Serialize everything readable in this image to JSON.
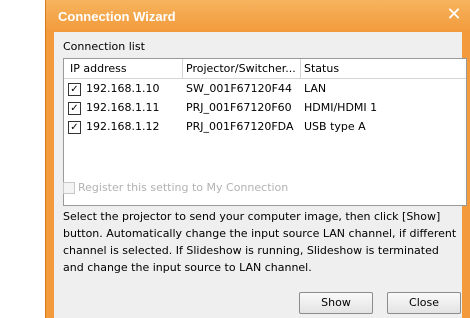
{
  "window": {
    "title": "Connection Wizard",
    "close_glyph": "✕",
    "accent_color": "#f39a3c"
  },
  "list": {
    "label": "Connection list",
    "columns": [
      "IP address",
      "Projector/Switcher...",
      "Status"
    ],
    "rows": [
      {
        "checked": true,
        "ip": "192.168.1.10",
        "device": "SW_001F67120F44",
        "status": "LAN"
      },
      {
        "checked": true,
        "ip": "192.168.1.11",
        "device": "PRJ_001F67120F60",
        "status": "HDMI/HDMI 1"
      },
      {
        "checked": true,
        "ip": "192.168.1.12",
        "device": "PRJ_001F67120FDA",
        "status": "USB type A"
      }
    ]
  },
  "register": {
    "label": "Register this setting to My Connection",
    "checked": false,
    "enabled": false
  },
  "description": "Select the projector to send your computer image, then click [Show] button. Automatically change the input source LAN channel, if different channel is selected. If Slideshow is running, Slideshow is terminated and change the input source to LAN channel.",
  "buttons": {
    "show": "Show",
    "close": "Close"
  }
}
